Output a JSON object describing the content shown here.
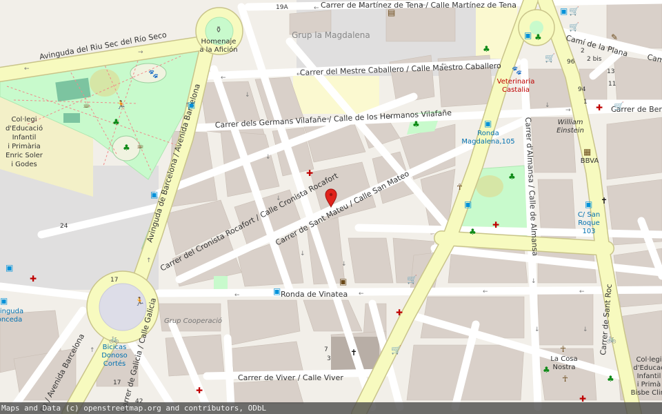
{
  "map": {
    "attribution": "Maps and Data (c) openstreetmap.org and contributors, ODbL",
    "streets": {
      "martinez_tena": "Carrer de Martínez de Tena / Calle Martínez de Tena",
      "riu_sec": "Avinguda del Riu Sec del Río Seco",
      "mestre_caballero": "Carrer del Mestre Caballero / Calle Maestro Caballero",
      "germans_vilafane": "Carrer dels Germans Vilafañe / Calle de los Hermanos Vilafañe",
      "cronista": "Carrer del Cronista Rocafort / Calle Cronista Rocafort",
      "sant_mateu": "Carrer de Sant Mateu / Calle San Mateo",
      "ronda_vinatea": "Ronda de Vinatea",
      "av_barcelona": "Avinguda de Barcelona / Avenida Barcelona",
      "av_barcelona_sw": "na / Avenida Barcelona",
      "almansa": "Carrer d'Almansa / Calle de Almansa",
      "sant_roc": "Carrer de Sant Roc",
      "cami_plana": "Camí de la Plana",
      "berna_partial": "Carrer de Berna",
      "cami_partial": "Cam",
      "galicia": "Carrer de Galicia / Calle Galicia",
      "viver": "Carrer de Viver / Calle Viver"
    },
    "places": {
      "homenaje_line1": "Homenaje",
      "homenaje_line2": "a la Afición",
      "grup_magdalena": "Grup la Magdalena",
      "school_line1": "Col·legi",
      "school_line2": "d'Educació",
      "school_line3": "Infantil",
      "school_line4": "i Primària",
      "school_line5": "Enric Soler",
      "school_line6": "i Godes",
      "veterinaria_line1": "Veterinaria",
      "veterinaria_line2": "Castalia",
      "ronda_mag_line1": "Ronda",
      "ronda_mag_line2": "Magdalena,105",
      "william_line1": "William",
      "william_line2": "Einstein",
      "bbva": "BBVA",
      "sanroque_line1": "C/ San",
      "sanroque_line2": "Roque",
      "sanroque_line3": "103",
      "grup_cooperacio": "Grup Cooperació",
      "bicicas_line1": "Bicicas",
      "bicicas_line2": "Donoso",
      "bicicas_line3": "Cortés",
      "lacosa_line1": "La Cosa",
      "lacosa_line2": "Nostra",
      "concepcion_line1": "vinguda",
      "concepcion_line2": "onceda",
      "school2_line1": "Col·legi",
      "school2_line2": "d'Educac",
      "school2_line3": "Infantil",
      "school2_line4": "i Primà",
      "school2_line5": "Bisbe Clim"
    },
    "housenumbers": {
      "n19a": "19A",
      "n24": "24",
      "n17": "17",
      "n2": "2",
      "n2bis": "2 bis",
      "n96": "96",
      "n94": "94",
      "n13": "13",
      "n11": "11",
      "n1": "1",
      "n7": "7",
      "n3": "3",
      "n17b": "17",
      "n42": "42"
    },
    "colors": {
      "background": "#f2efe9",
      "building": "#d9d0c9",
      "park": "#c8facc",
      "primary_road": "#f7fabf",
      "residential_road": "#ffffff",
      "marker": "#e0231c",
      "poi_shop": "#ac39ac",
      "poi_health": "#bf0000",
      "poi_transport": "#0092da",
      "poi_leisure": "#0e8a17"
    }
  }
}
